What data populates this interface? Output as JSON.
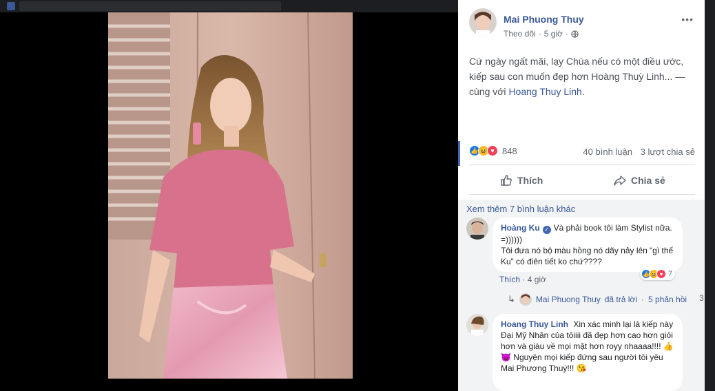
{
  "post": {
    "author": "Mai Phuong Thuy",
    "follow_label": "Theo dõi",
    "time": "5 giờ",
    "text_main": "Cứ ngày ngất mãi, lạy Chúa nếu có một điều ước, kiếp sau con muốn đẹp hơn Hoàng Thuỳ Linh... — cùng với ",
    "tagged": "Hoang Thuy Linh",
    "text_end": ".",
    "reaction_count": "848",
    "comment_count": "40 bình luận",
    "share_count": "3 lượt chia sẻ",
    "like_label": "Thích",
    "share_label": "Chia sẻ",
    "more_icon": "•••"
  },
  "comments": {
    "view_more": "Xem thêm 7 bình luận khác",
    "items": [
      {
        "name": "Hoàng Ku",
        "line1": "Và phải book tôi làm Stylist nữa. =))))))",
        "line2": "Tôi đưa nó bộ màu hồng nó dãy nảy lên “gì thế Ku” có điên tiết ko chứ????",
        "like": "Thích",
        "time": "4 giờ",
        "reactions": "7"
      },
      {
        "name": "Hoang Thuy Linh",
        "text": "Xin xác minh lại là kiếp này Đại Mỹ Nhân của tôiiii đã đẹp hơn cao hơn giỏi hơn và giàu về mọi mặt hơn royy nhaaaa!!!! 👍😈 Nguyện mọi kiếp đứng sau người tôi yêu Mai Phương Thuý!!! 😘"
      }
    ],
    "reply": {
      "name": "Mai Phuong Thuy",
      "action": "đã trả lời",
      "dot": "·",
      "count": "5 phản hồi",
      "overflow": "3"
    }
  },
  "colors": {
    "link": "#385898",
    "accent": "#4267b2",
    "muted": "#606770"
  }
}
